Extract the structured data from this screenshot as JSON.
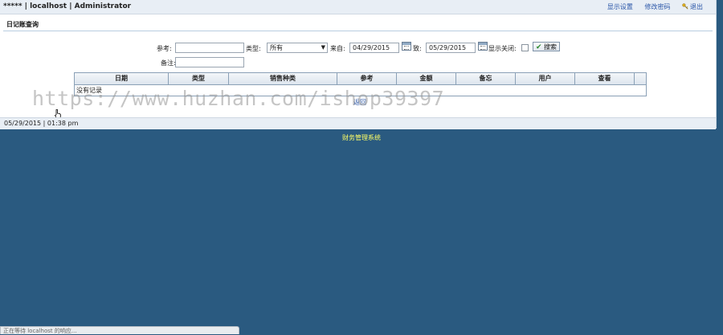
{
  "header": {
    "title": "***** | localhost | Administrator",
    "links": {
      "display_settings": "显示设置",
      "change_password": "修改密码",
      "logout": "退出"
    }
  },
  "page": {
    "title": "日记账查询"
  },
  "filters": {
    "reference_label": "参考:",
    "reference_value": "",
    "type_label": "类型:",
    "type_value": "所有",
    "from_label": "来自:",
    "from_value": "04/29/2015",
    "to_label": "致:",
    "to_value": "05/29/2015",
    "show_closed_label": "显示关闭:",
    "search_label": "搜索",
    "memo_label": "备注:",
    "memo_value": ""
  },
  "table": {
    "columns": [
      "日期",
      "类型",
      "销售种类",
      "参考",
      "金额",
      "备忘",
      "用户",
      "查看"
    ],
    "empty_message": "没有记录"
  },
  "pager": {
    "back_label": "返回"
  },
  "watermark": "https://www.huzhan.com/ishop39397",
  "status": {
    "datetime": "05/29/2015 | 01:38 pm"
  },
  "footer": {
    "text": "财务管理系统"
  },
  "browser_status": "正在等待 localhost 的响应...",
  "colors": {
    "background": "#2a5a80",
    "link": "#2a56a8",
    "footer_text": "#ffff66"
  }
}
